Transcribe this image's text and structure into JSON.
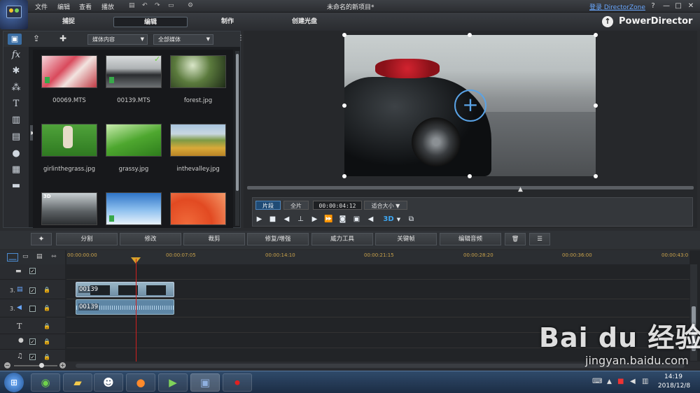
{
  "title_bar": {
    "menu": [
      "文件",
      "编辑",
      "查看",
      "播放"
    ],
    "project_title": "未命名的新项目*",
    "login_link": "登录 DirectorZone",
    "help": "?",
    "minimize": "—",
    "maximize": "□",
    "close": "✕"
  },
  "mode_tabs": {
    "capture": "捕捉",
    "edit": "编辑",
    "produce": "制作",
    "create_disc": "创建光盘"
  },
  "brand": "PowerDirector",
  "library": {
    "content_dropdown": "媒体内容",
    "filter_dropdown": "全部媒体",
    "items": [
      {
        "name": "00069.MTS"
      },
      {
        "name": "00139.MTS"
      },
      {
        "name": "forest.jpg"
      },
      {
        "name": "girlinthegrass.jpg"
      },
      {
        "name": "grassy.jpg"
      },
      {
        "name": "inthevalley.jpg"
      }
    ],
    "third_row_badge": "3D"
  },
  "preview_controls": {
    "clip_tab": "片段",
    "movie_tab": "全片",
    "timecode": "00:00:04:12",
    "fit_dropdown": "适合大小",
    "mode_3d": "3D"
  },
  "edit_toolbar": {
    "split": "分割",
    "modify": "修改",
    "trim": "裁剪",
    "fix_enhance": "修复/增强",
    "power_tools": "威力工具",
    "keyframe": "关键帧",
    "edit_audio": "编辑音频"
  },
  "timeline": {
    "ticks": [
      "00:00:00:00",
      "00:00:07:05",
      "00:00:14:10",
      "00:00:21:15",
      "00:00:28:20",
      "00:00:36:00",
      "00:00:43:0"
    ],
    "track_number_video": "3.",
    "track_number_audio": "3.",
    "video_clip_label": "00139",
    "audio_clip_label": "00139"
  },
  "taskbar": {
    "time": "14:19",
    "date": "2018/12/8"
  },
  "watermark": {
    "text": "Bai du 经验",
    "url": "jingyan.baidu.com"
  }
}
